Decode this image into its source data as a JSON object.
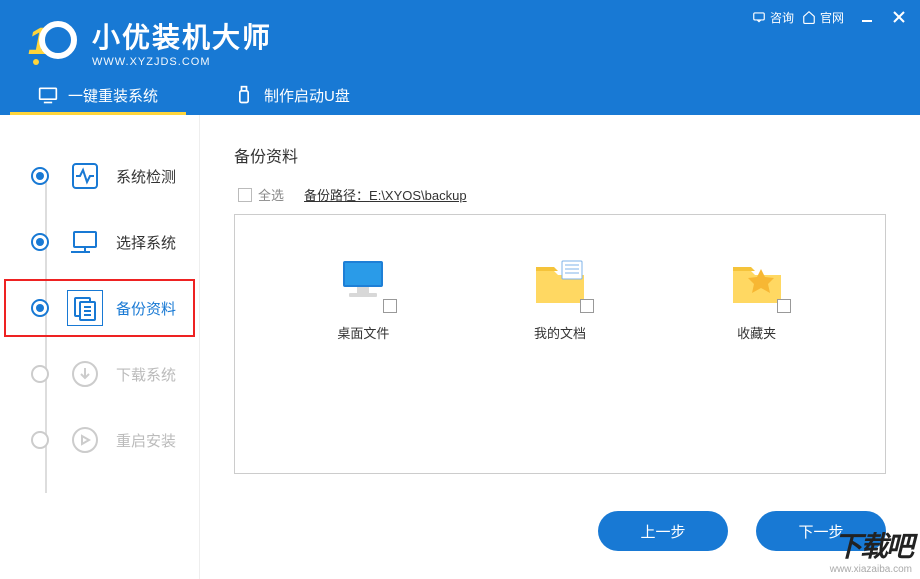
{
  "topbar": {
    "consult": "咨询",
    "website": "官网"
  },
  "app": {
    "title": "小优装机大师",
    "url": "WWW.XYZJDS.COM"
  },
  "tabs": {
    "reinstall": "一键重装系统",
    "usb": "制作启动U盘"
  },
  "steps": [
    {
      "label": "系统检测"
    },
    {
      "label": "选择系统"
    },
    {
      "label": "备份资料"
    },
    {
      "label": "下载系统"
    },
    {
      "label": "重启安装"
    }
  ],
  "main": {
    "title": "备份资料",
    "select_all": "全选",
    "path_prefix": "备份路径：",
    "path": "E:\\XYOS\\backup"
  },
  "items": [
    {
      "label": "桌面文件"
    },
    {
      "label": "我的文档"
    },
    {
      "label": "收藏夹"
    }
  ],
  "buttons": {
    "prev": "上一步",
    "next": "下一步"
  },
  "watermark": {
    "logo": "下载吧",
    "url": "www.xiazaiba.com"
  }
}
